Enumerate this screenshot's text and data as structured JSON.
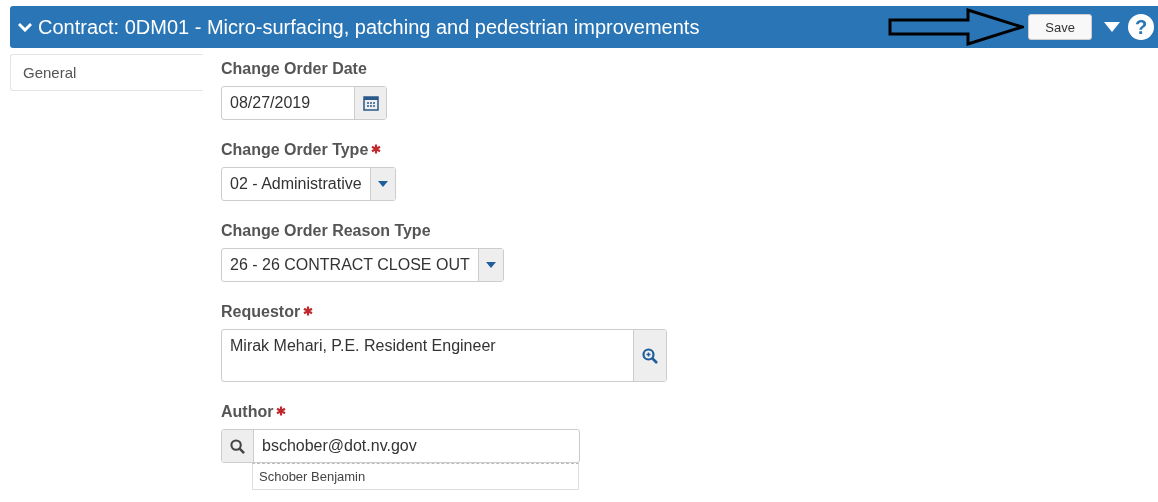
{
  "header": {
    "title": "Contract: 0DM01 - Micro-surfacing, patching and pedestrian improvements",
    "expanded": true,
    "save_button": "Save",
    "help_button": "?"
  },
  "sidebar": {
    "items": [
      {
        "label": "General",
        "selected": true
      }
    ]
  },
  "fields": [
    {
      "kind": "date",
      "label": "Change Order Date",
      "required": false,
      "value": "08/27/2019"
    },
    {
      "kind": "select",
      "label": "Change Order Type",
      "required": true,
      "value": "02 - Administrative"
    },
    {
      "kind": "select",
      "label": "Change Order Reason Type",
      "required": false,
      "value": "26 - 26 CONTRACT CLOSE OUT"
    },
    {
      "kind": "lookup",
      "label": "Requestor",
      "required": true,
      "value": "Mirak Mehari, P.E. Resident Engineer"
    },
    {
      "kind": "search",
      "label": "Author",
      "required": true,
      "value": "bschober@dot.nv.gov",
      "suggestions": [
        "Schober Benjamin"
      ]
    }
  ]
}
